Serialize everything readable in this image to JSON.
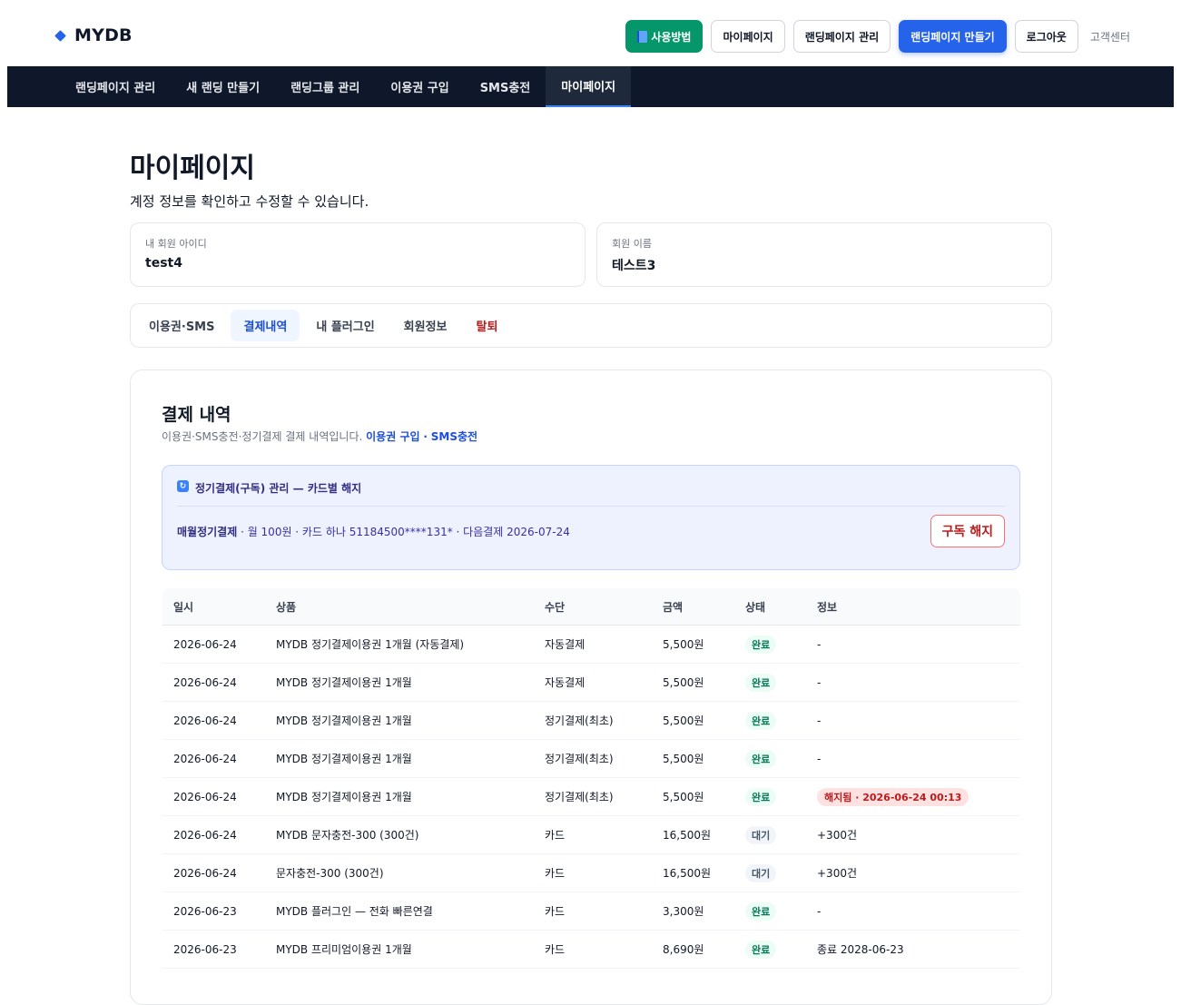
{
  "header": {
    "logo": "MYDB",
    "buttons": {
      "guide": "사용방법",
      "mypage": "마이페이지",
      "landing_manage": "랜딩페이지 관리",
      "landing_create": "랜딩페이지 만들기",
      "logout": "로그아웃",
      "support": "고객센터"
    }
  },
  "nav": {
    "items": [
      "랜딩페이지 관리",
      "새 랜딩 만들기",
      "랜딩그룹 관리",
      "이용권 구입",
      "SMS충전",
      "마이페이지"
    ],
    "active": "마이페이지"
  },
  "page": {
    "title": "마이페이지",
    "subtitle": "계정 정보를 확인하고 수정할 수 있습니다."
  },
  "account": {
    "id_label": "내 회원 아이디",
    "id_value": "test4",
    "name_label": "회원 이름",
    "name_value": "테스트3"
  },
  "tabs": [
    "이용권·SMS",
    "결제내역",
    "내 플러그인",
    "회원정보",
    "탈퇴"
  ],
  "payments": {
    "title": "결제 내역",
    "subtitle": "이용권·SMS충전·정기결제 결제 내역입니다.",
    "link_ticket": "이용권 구입",
    "link_sep": "·",
    "link_sms": "SMS충전",
    "subscription": {
      "heading": "정기결제(구독) 관리 — 카드별 해지",
      "plan": "매월정기결제",
      "detail": " · 월 100원 · 카드 하나 51184500****131* · 다음결제 2026-07-24",
      "cancel_label": "구독 해지"
    },
    "columns": [
      "일시",
      "상품",
      "수단",
      "금액",
      "상태",
      "정보"
    ],
    "rows": [
      {
        "date": "2026-06-24",
        "product": "MYDB 정기결제이용권 1개월 (자동결제)",
        "method": "자동결제",
        "amount": "5,500원",
        "status": "완료",
        "info": "-"
      },
      {
        "date": "2026-06-24",
        "product": "MYDB 정기결제이용권 1개월",
        "method": "자동결제",
        "amount": "5,500원",
        "status": "완료",
        "info": "-"
      },
      {
        "date": "2026-06-24",
        "product": "MYDB 정기결제이용권 1개월",
        "method": "정기결제(최초)",
        "amount": "5,500원",
        "status": "완료",
        "info": "-"
      },
      {
        "date": "2026-06-24",
        "product": "MYDB 정기결제이용권 1개월",
        "method": "정기결제(최초)",
        "amount": "5,500원",
        "status": "완료",
        "info": "-"
      },
      {
        "date": "2026-06-24",
        "product": "MYDB 정기결제이용권 1개월",
        "method": "정기결제(최초)",
        "amount": "5,500원",
        "status": "완료",
        "info": "해지됨 · 2026-06-24 00:13"
      },
      {
        "date": "2026-06-24",
        "product": "MYDB 문자충전-300 (300건)",
        "method": "카드",
        "amount": "16,500원",
        "status": "대기",
        "info": "+300건"
      },
      {
        "date": "2026-06-24",
        "product": "문자충전-300 (300건)",
        "method": "카드",
        "amount": "16,500원",
        "status": "대기",
        "info": "+300건"
      },
      {
        "date": "2026-06-23",
        "product": "MYDB 플러그인 — 전화 빠른연결",
        "method": "카드",
        "amount": "3,300원",
        "status": "완료",
        "info": "-"
      },
      {
        "date": "2026-06-23",
        "product": "MYDB 프리미엄이용권 1개월",
        "method": "카드",
        "amount": "8,690원",
        "status": "완료",
        "info": "종료 2028-06-23"
      }
    ]
  },
  "colors": {
    "accent": "#2563eb",
    "nav_bg": "#0f172a",
    "green": "#059669",
    "danger": "#b91c1c"
  }
}
